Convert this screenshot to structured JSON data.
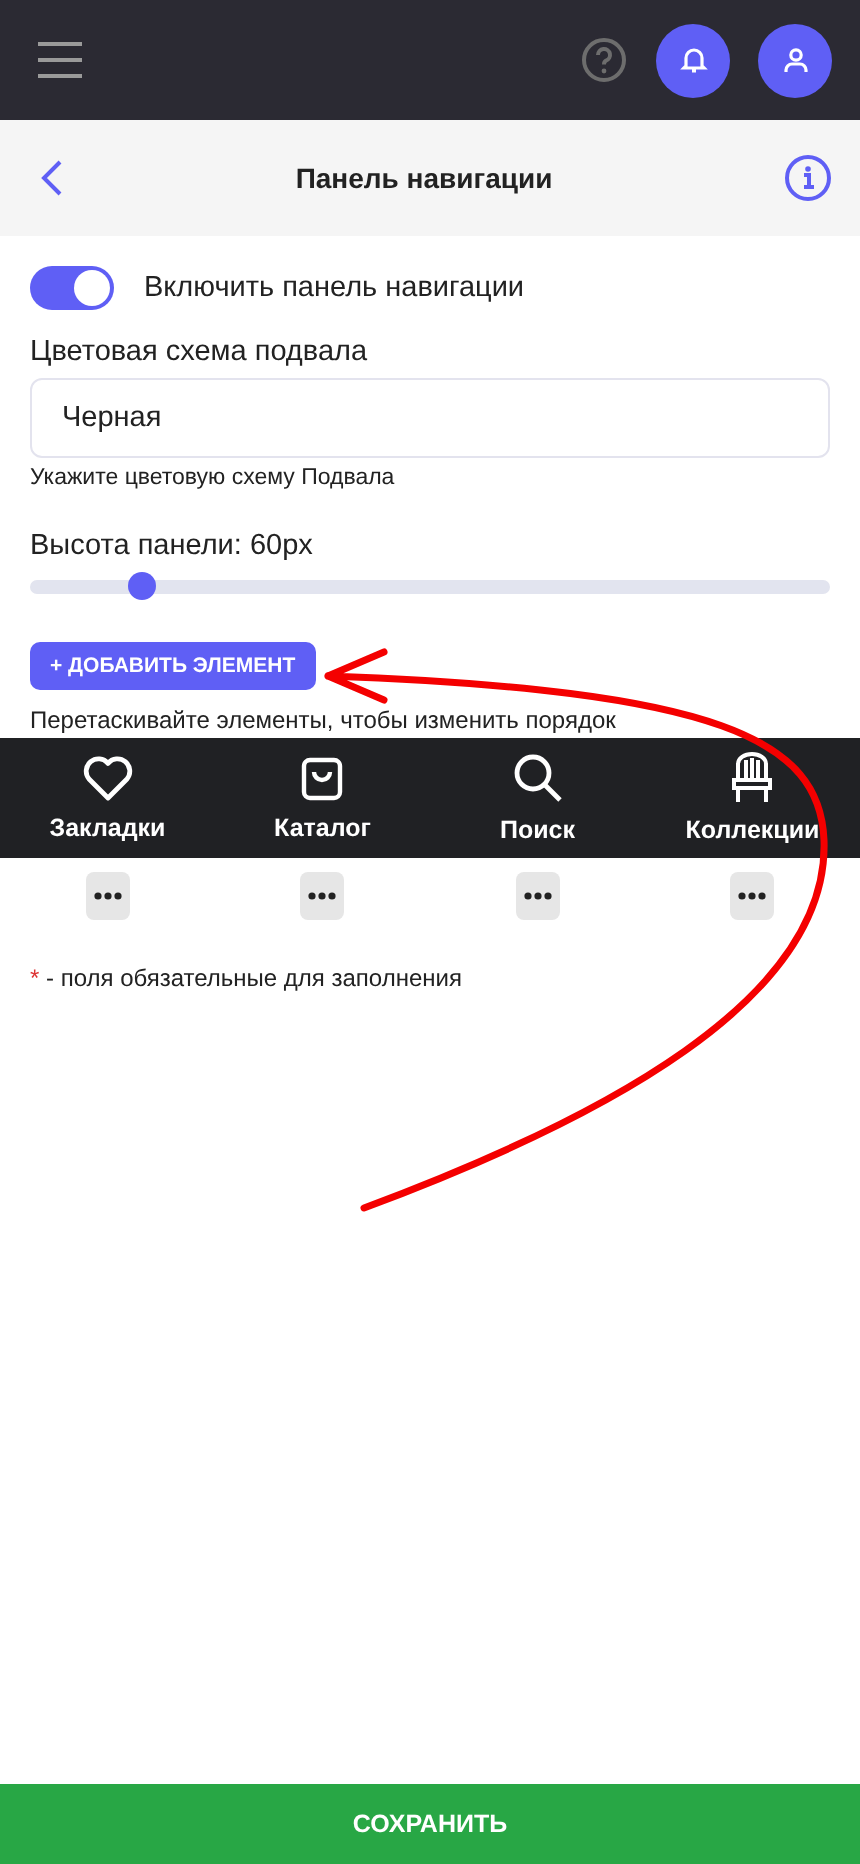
{
  "page_header": {
    "title": "Панель навигации"
  },
  "toggle": {
    "label": "Включить панель навигации",
    "on": true
  },
  "color_scheme": {
    "label": "Цветовая схема подвала",
    "value": "Черная",
    "hint": "Укажите цветовую схему Подвала"
  },
  "height": {
    "label": "Высота панели: 60px",
    "level": 0.14
  },
  "add_button": "+ ДОБАВИТЬ ЭЛЕМЕНТ",
  "drag_hint": "Перетаскивайте элементы, чтобы изменить порядок",
  "nav_items": [
    {
      "kind": "heart",
      "label": "Закладки"
    },
    {
      "kind": "bag",
      "label": "Каталог"
    },
    {
      "kind": "search",
      "label": "Поиск"
    },
    {
      "kind": "chair",
      "label": "Коллекции"
    }
  ],
  "required_note": {
    "mark": "*",
    "text": "- поля обязательные для заполнения"
  },
  "save_button": "СОХРАНИТЬ"
}
